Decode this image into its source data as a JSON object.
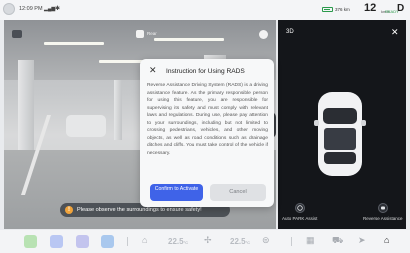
{
  "status_bar": {
    "time": "12:09 PM",
    "range": "376 km",
    "speed": "12",
    "speed_unit": "km/h",
    "ready": "READY",
    "gear": "D"
  },
  "camera": {
    "top_center_label": "Rear",
    "safety_message": "Please observe the surroundings to ensure safety!"
  },
  "right_panel": {
    "view_toggle": "3D",
    "buttons": [
      {
        "label": "Auto PARK Assist",
        "icon": "parking-assist-icon"
      },
      {
        "label": "Reverse Assistance",
        "icon": "reverse-assist-icon"
      }
    ]
  },
  "modal": {
    "title": "Instruction for Using RADS",
    "body": "Reverse Assistance Driving System (RADS) is a driving assistance feature. As the primary responsible person for using this feature, you are responsible for supervising its safety and must comply with relevant laws and regulations. During use, please pay attention to your surroundings, including but not limited to crossing pedestrians, vehicles, and other moving objects, as well as road conditions such as drainage ditches and cliffs. You must take control of the vehicle if necessary.",
    "confirm_label": "Confirm to Activate",
    "cancel_label": "Cancel"
  },
  "dock": {
    "left_temp": "22.5",
    "right_temp": "22.5",
    "temp_unit": "°C"
  },
  "colors": {
    "accent": "#3f63e8",
    "warning": "#f0a33b",
    "ready": "#2a9a4b"
  }
}
